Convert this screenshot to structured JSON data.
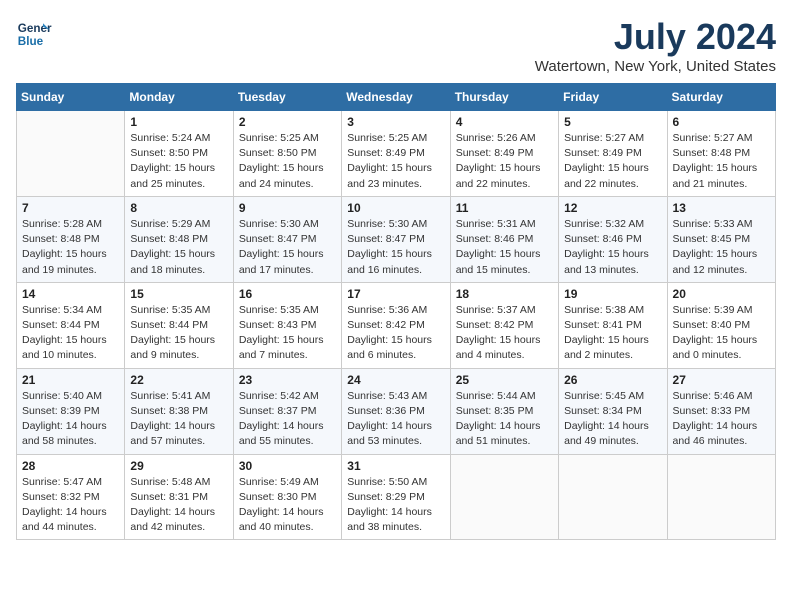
{
  "header": {
    "logo_line1": "General",
    "logo_line2": "Blue",
    "title": "July 2024",
    "subtitle": "Watertown, New York, United States"
  },
  "columns": [
    "Sunday",
    "Monday",
    "Tuesday",
    "Wednesday",
    "Thursday",
    "Friday",
    "Saturday"
  ],
  "weeks": [
    [
      {
        "day": "",
        "text": ""
      },
      {
        "day": "1",
        "text": "Sunrise: 5:24 AM\nSunset: 8:50 PM\nDaylight: 15 hours\nand 25 minutes."
      },
      {
        "day": "2",
        "text": "Sunrise: 5:25 AM\nSunset: 8:50 PM\nDaylight: 15 hours\nand 24 minutes."
      },
      {
        "day": "3",
        "text": "Sunrise: 5:25 AM\nSunset: 8:49 PM\nDaylight: 15 hours\nand 23 minutes."
      },
      {
        "day": "4",
        "text": "Sunrise: 5:26 AM\nSunset: 8:49 PM\nDaylight: 15 hours\nand 22 minutes."
      },
      {
        "day": "5",
        "text": "Sunrise: 5:27 AM\nSunset: 8:49 PM\nDaylight: 15 hours\nand 22 minutes."
      },
      {
        "day": "6",
        "text": "Sunrise: 5:27 AM\nSunset: 8:48 PM\nDaylight: 15 hours\nand 21 minutes."
      }
    ],
    [
      {
        "day": "7",
        "text": "Sunrise: 5:28 AM\nSunset: 8:48 PM\nDaylight: 15 hours\nand 19 minutes."
      },
      {
        "day": "8",
        "text": "Sunrise: 5:29 AM\nSunset: 8:48 PM\nDaylight: 15 hours\nand 18 minutes."
      },
      {
        "day": "9",
        "text": "Sunrise: 5:30 AM\nSunset: 8:47 PM\nDaylight: 15 hours\nand 17 minutes."
      },
      {
        "day": "10",
        "text": "Sunrise: 5:30 AM\nSunset: 8:47 PM\nDaylight: 15 hours\nand 16 minutes."
      },
      {
        "day": "11",
        "text": "Sunrise: 5:31 AM\nSunset: 8:46 PM\nDaylight: 15 hours\nand 15 minutes."
      },
      {
        "day": "12",
        "text": "Sunrise: 5:32 AM\nSunset: 8:46 PM\nDaylight: 15 hours\nand 13 minutes."
      },
      {
        "day": "13",
        "text": "Sunrise: 5:33 AM\nSunset: 8:45 PM\nDaylight: 15 hours\nand 12 minutes."
      }
    ],
    [
      {
        "day": "14",
        "text": "Sunrise: 5:34 AM\nSunset: 8:44 PM\nDaylight: 15 hours\nand 10 minutes."
      },
      {
        "day": "15",
        "text": "Sunrise: 5:35 AM\nSunset: 8:44 PM\nDaylight: 15 hours\nand 9 minutes."
      },
      {
        "day": "16",
        "text": "Sunrise: 5:35 AM\nSunset: 8:43 PM\nDaylight: 15 hours\nand 7 minutes."
      },
      {
        "day": "17",
        "text": "Sunrise: 5:36 AM\nSunset: 8:42 PM\nDaylight: 15 hours\nand 6 minutes."
      },
      {
        "day": "18",
        "text": "Sunrise: 5:37 AM\nSunset: 8:42 PM\nDaylight: 15 hours\nand 4 minutes."
      },
      {
        "day": "19",
        "text": "Sunrise: 5:38 AM\nSunset: 8:41 PM\nDaylight: 15 hours\nand 2 minutes."
      },
      {
        "day": "20",
        "text": "Sunrise: 5:39 AM\nSunset: 8:40 PM\nDaylight: 15 hours\nand 0 minutes."
      }
    ],
    [
      {
        "day": "21",
        "text": "Sunrise: 5:40 AM\nSunset: 8:39 PM\nDaylight: 14 hours\nand 58 minutes."
      },
      {
        "day": "22",
        "text": "Sunrise: 5:41 AM\nSunset: 8:38 PM\nDaylight: 14 hours\nand 57 minutes."
      },
      {
        "day": "23",
        "text": "Sunrise: 5:42 AM\nSunset: 8:37 PM\nDaylight: 14 hours\nand 55 minutes."
      },
      {
        "day": "24",
        "text": "Sunrise: 5:43 AM\nSunset: 8:36 PM\nDaylight: 14 hours\nand 53 minutes."
      },
      {
        "day": "25",
        "text": "Sunrise: 5:44 AM\nSunset: 8:35 PM\nDaylight: 14 hours\nand 51 minutes."
      },
      {
        "day": "26",
        "text": "Sunrise: 5:45 AM\nSunset: 8:34 PM\nDaylight: 14 hours\nand 49 minutes."
      },
      {
        "day": "27",
        "text": "Sunrise: 5:46 AM\nSunset: 8:33 PM\nDaylight: 14 hours\nand 46 minutes."
      }
    ],
    [
      {
        "day": "28",
        "text": "Sunrise: 5:47 AM\nSunset: 8:32 PM\nDaylight: 14 hours\nand 44 minutes."
      },
      {
        "day": "29",
        "text": "Sunrise: 5:48 AM\nSunset: 8:31 PM\nDaylight: 14 hours\nand 42 minutes."
      },
      {
        "day": "30",
        "text": "Sunrise: 5:49 AM\nSunset: 8:30 PM\nDaylight: 14 hours\nand 40 minutes."
      },
      {
        "day": "31",
        "text": "Sunrise: 5:50 AM\nSunset: 8:29 PM\nDaylight: 14 hours\nand 38 minutes."
      },
      {
        "day": "",
        "text": ""
      },
      {
        "day": "",
        "text": ""
      },
      {
        "day": "",
        "text": ""
      }
    ]
  ]
}
